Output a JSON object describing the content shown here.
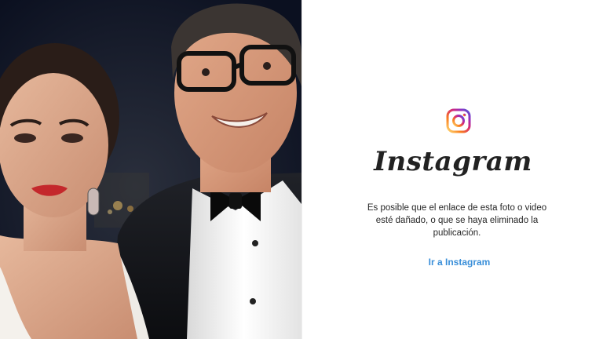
{
  "photo": {
    "icon": "news-photo-couple"
  },
  "embed": {
    "logo_icon": "instagram-icon",
    "wordmark": "Instagram",
    "message": "Es posible que el enlace de esta foto o video esté dañado, o que se haya eliminado la publicación.",
    "link_label": "Ir a Instagram"
  },
  "colors": {
    "link": "#3a8fd9",
    "text": "#262626",
    "brand_gradient": [
      "#feda75",
      "#fa7e1e",
      "#d62976",
      "#962fbf",
      "#4f5bd5"
    ]
  }
}
